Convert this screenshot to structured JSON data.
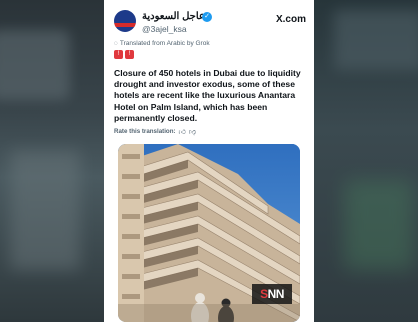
{
  "post": {
    "display_name": "عاجل السعودية",
    "verified_icon": "verified-badge-icon",
    "handle": "@3ajel_ksa",
    "site_label": "X.com",
    "translated_note": "Translated from Arabic by Grok",
    "body": "Closure of 450 hotels in Dubai due to liquidity drought and investor exodus, some of these hotels are recent like the luxurious Anantara Hotel on Palm Island, which has been permanently closed.",
    "rate_label": "Rate this translation:",
    "emojis": [
      "red-alert-icon",
      "red-alert-icon"
    ]
  },
  "watermark": {
    "s": "S",
    "nn": "NN"
  },
  "colors": {
    "accent": "#1d9bf0",
    "text": "#0f1419",
    "muted": "#536471",
    "watermark_red": "#e0393e"
  }
}
